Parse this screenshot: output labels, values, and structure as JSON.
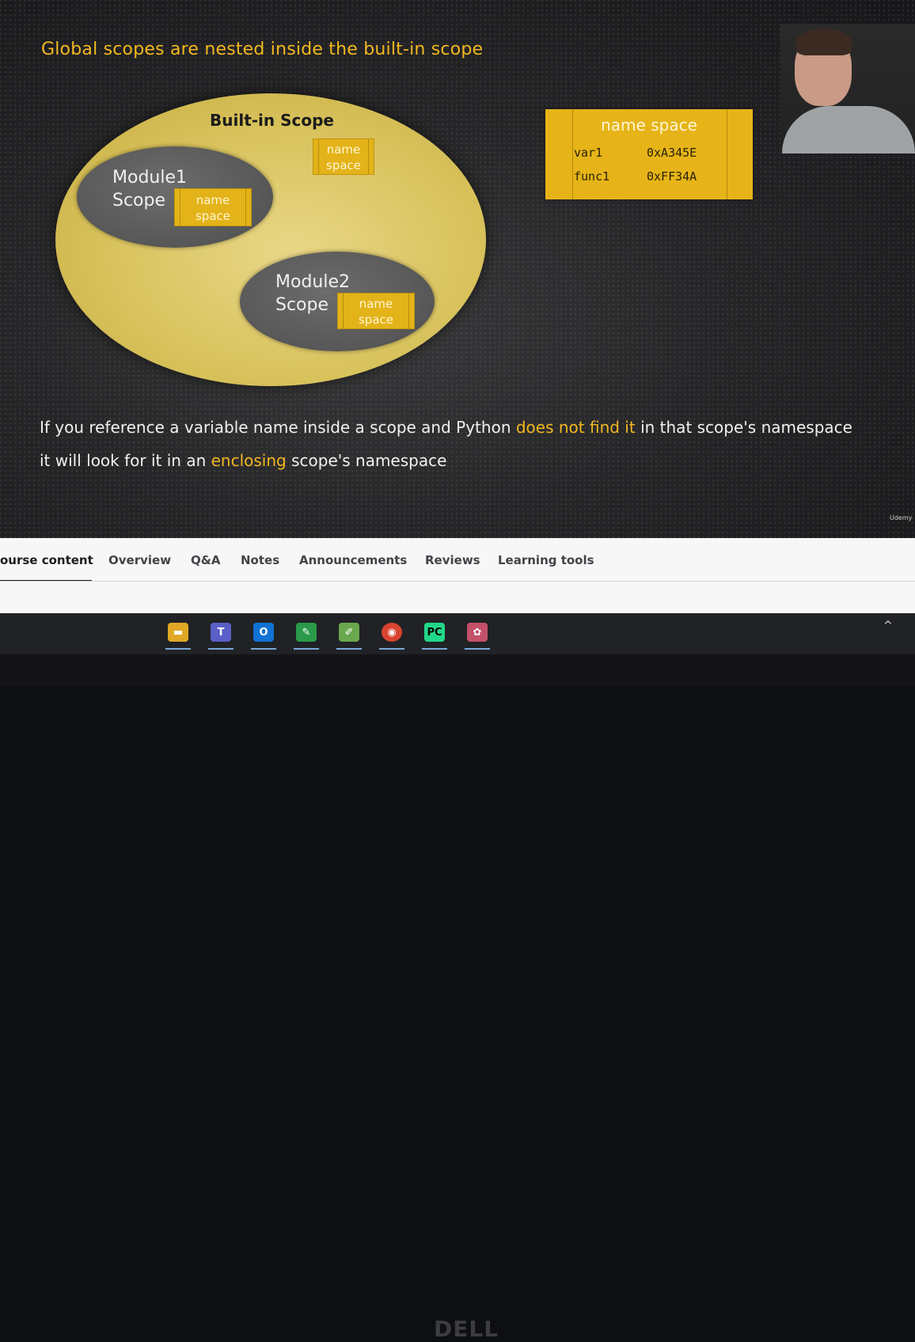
{
  "slide": {
    "title": "Global scopes are nested inside the built-in scope",
    "builtin_label": "Built-in Scope",
    "module1_label": "Module1\nScope",
    "module2_label": "Module2\nScope",
    "namespace_box_label": "name\nspace",
    "namespace_table": {
      "header": "name space",
      "rows": [
        {
          "name": "var1",
          "value": "0xA345E"
        },
        {
          "name": "func1",
          "value": "0xFF34A"
        }
      ]
    },
    "caption_line1": {
      "part1": "If you reference a variable name inside a scope and Python ",
      "highlight": "does not find it",
      "part2": " in that scope's namespace"
    },
    "caption_line2": {
      "part1": "it will look for it in an ",
      "highlight": "enclosing",
      "part2": " scope's namespace"
    },
    "watermark": "Udemy",
    "colors": {
      "accent": "#f2b81f",
      "builtin": "#d8c25c",
      "module": "#575757"
    }
  },
  "tabs": [
    {
      "label": "ourse content",
      "active": true
    },
    {
      "label": "Overview"
    },
    {
      "label": "Q&A"
    },
    {
      "label": "Notes"
    },
    {
      "label": "Announcements"
    },
    {
      "label": "Reviews"
    },
    {
      "label": "Learning tools"
    }
  ],
  "taskbar": {
    "icons": [
      "file-explorer-icon",
      "teams-icon",
      "outlook-icon",
      "pycharm-edu-icon",
      "notepad-icon",
      "chrome-icon",
      "pycharm-icon",
      "paint-icon"
    ]
  },
  "bezel_brand": "DELL"
}
